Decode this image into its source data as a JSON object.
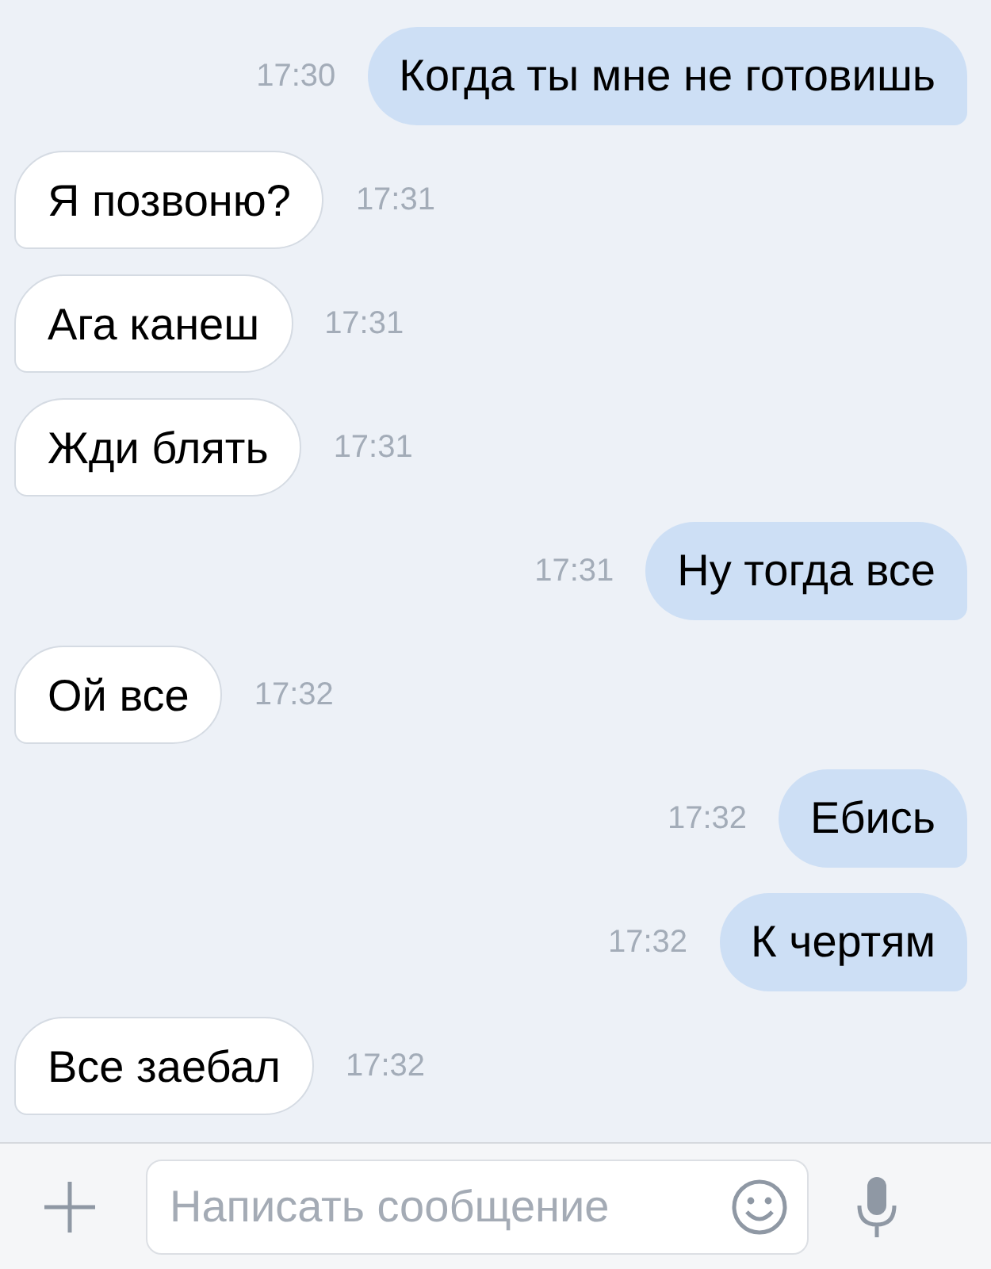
{
  "messages": [
    {
      "kind": "outgoing",
      "text": "Когда ты мне не готовишь",
      "time": "17:30"
    },
    {
      "kind": "incoming",
      "text": "Я позвоню?",
      "time": "17:31"
    },
    {
      "kind": "incoming",
      "text": "Ага канеш",
      "time": "17:31"
    },
    {
      "kind": "incoming",
      "text": "Жди блять",
      "time": "17:31"
    },
    {
      "kind": "outgoing",
      "text": "Ну тогда все",
      "time": "17:31"
    },
    {
      "kind": "incoming",
      "text": "Ой все",
      "time": "17:32"
    },
    {
      "kind": "outgoing",
      "text": "Ебись",
      "time": "17:32"
    },
    {
      "kind": "outgoing",
      "text": "К чертям",
      "time": "17:32"
    },
    {
      "kind": "incoming",
      "text": "Все заебал",
      "time": "17:32"
    }
  ],
  "composer": {
    "placeholder": "Написать сообщение"
  }
}
